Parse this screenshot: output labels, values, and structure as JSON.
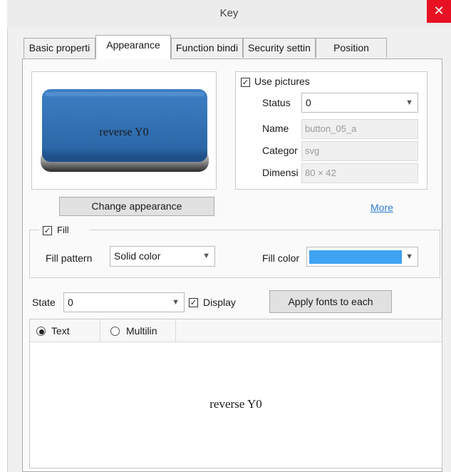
{
  "window": {
    "title": "Key",
    "close_glyph": "✕"
  },
  "tabs": [
    {
      "label": "Basic properti",
      "active": false
    },
    {
      "label": "Appearance",
      "active": true
    },
    {
      "label": "Function bindi",
      "active": false
    },
    {
      "label": "Security settin",
      "active": false
    },
    {
      "label": "Position",
      "active": false
    }
  ],
  "preview": {
    "button_text": "reverse Y0",
    "button_color": "#2f6fb6"
  },
  "use_pictures": {
    "label": "Use pictures",
    "checked": true,
    "status_label": "Status",
    "status_value": "0",
    "name_label": "Name",
    "name_value": "button_05_a",
    "category_label": "Categor",
    "category_value": "svg",
    "dimension_label": "Dimensi",
    "dimension_value": "80 × 42"
  },
  "change_appearance_label": "Change appearance",
  "more_link": "More",
  "fill": {
    "label": "Fill",
    "checked": true,
    "pattern_label": "Fill pattern",
    "pattern_value": "Solid color",
    "color_label": "Fill color",
    "color_value": "#3fa3f2"
  },
  "state": {
    "label": "State",
    "value": "0"
  },
  "display": {
    "label": "Display",
    "checked": true
  },
  "apply_fonts_label": "Apply fonts to each",
  "text_mode": {
    "text_label": "Text",
    "multiline_label": "Multilin",
    "selected": "text"
  },
  "text_preview": "reverse Y0"
}
